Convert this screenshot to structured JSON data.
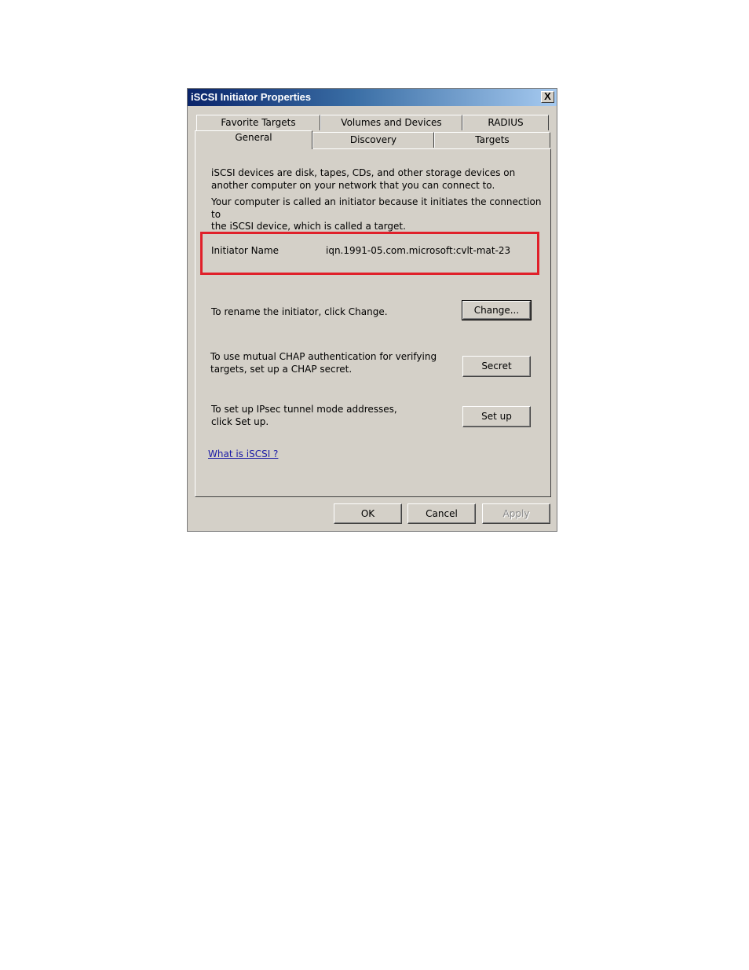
{
  "window": {
    "title": "iSCSI Initiator Properties",
    "close_glyph": "X"
  },
  "tabs": {
    "row_back": [
      "Favorite Targets",
      "Volumes and Devices",
      "RADIUS"
    ],
    "row_front": [
      "General",
      "Discovery",
      "Targets"
    ],
    "active": "General"
  },
  "general": {
    "intro_line1": "iSCSI devices are disk, tapes, CDs, and other storage devices on",
    "intro_line2": "another computer on your network that you can connect to.",
    "computer_line1": "Your computer is called an initiator because it initiates the connection to",
    "computer_line2": "the iSCSI device, which is called a target.",
    "initiator_label": "Initiator Name",
    "initiator_value": "iqn.1991-05.com.microsoft:cvlt-mat-23",
    "rename_text": "To rename the initiator, click Change.",
    "change_button": "Change...",
    "chap_line1": "To use mutual CHAP authentication for verifying",
    "chap_line2": "targets, set up a CHAP secret.",
    "secret_button": "Secret",
    "ipsec_line1": "To set up IPsec tunnel mode addresses,",
    "ipsec_line2": "click Set up.",
    "setup_button": "Set up",
    "help_link": "What is iSCSI ?"
  },
  "footer": {
    "ok_button": "OK",
    "cancel_button": "Cancel",
    "apply_button": "Apply"
  },
  "colors": {
    "dialog_face": "#d4d0c8",
    "title_bar_start": "#0a246a",
    "title_bar_end": "#a6caf0",
    "highlight_box": "#e0202a",
    "link": "#1a1aa6"
  }
}
